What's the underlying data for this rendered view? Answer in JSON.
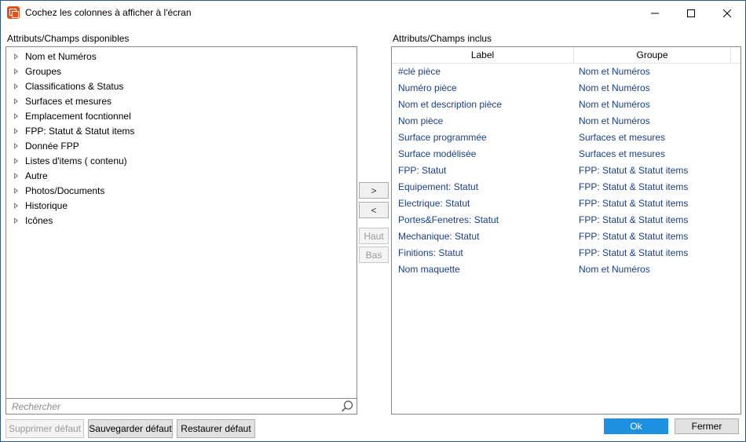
{
  "window": {
    "title": "Cochez les colonnes à afficher à l'écran"
  },
  "available": {
    "heading": "Attributs/Champs disponibles",
    "items": [
      {
        "label": "Nom et Numéros"
      },
      {
        "label": "Groupes"
      },
      {
        "label": "Classifications & Status"
      },
      {
        "label": "Surfaces et mesures"
      },
      {
        "label": "Emplacement focntionnel"
      },
      {
        "label": "FPP: Statut & Statut items"
      },
      {
        "label": "Donnée FPP"
      },
      {
        "label": "Listes d'items ( contenu)"
      },
      {
        "label": "Autre"
      },
      {
        "label": "Photos/Documents"
      },
      {
        "label": "Historique"
      },
      {
        "label": "Icônes"
      }
    ],
    "search_placeholder": "Rechercher"
  },
  "included": {
    "heading": "Attributs/Champs inclus",
    "columns": {
      "label": "Label",
      "group": "Groupe"
    },
    "rows": [
      {
        "label": "#clé pièce",
        "group": "Nom et Numéros"
      },
      {
        "label": "Numéro pièce",
        "group": "Nom et Numéros"
      },
      {
        "label": "Nom et description pièce",
        "group": "Nom et Numéros"
      },
      {
        "label": "Nom pièce",
        "group": "Nom et Numéros"
      },
      {
        "label": "Surface programmée",
        "group": "Surfaces et mesures"
      },
      {
        "label": "Surface modélisée",
        "group": "Surfaces et mesures"
      },
      {
        "label": "FPP: Statut",
        "group": "FPP: Statut & Statut items"
      },
      {
        "label": "Equipement: Statut",
        "group": "FPP: Statut & Statut items"
      },
      {
        "label": "Electrique: Statut",
        "group": "FPP: Statut & Statut items"
      },
      {
        "label": "Portes&Fenetres: Statut",
        "group": "FPP: Statut & Statut items"
      },
      {
        "label": "Mechanique: Statut",
        "group": "FPP: Statut & Statut items"
      },
      {
        "label": "Finitions: Statut",
        "group": "FPP: Statut & Statut items"
      },
      {
        "label": "Nom maquette",
        "group": "Nom et Numéros"
      }
    ]
  },
  "transfer": {
    "add": ">",
    "remove": "<",
    "up": "Haut",
    "down": "Bas"
  },
  "footer": {
    "delete_default": "Supprimer défaut",
    "save_default": "Sauvegarder défaut",
    "restore_default": "Restaurer défaut",
    "ok": "Ok",
    "close": "Fermer"
  },
  "colors": {
    "accent": "#1e90e0",
    "grid_text": "#1a3f8a",
    "window_border": "#2b579a",
    "app_icon": "#e0521f"
  },
  "icons": {
    "app": "app-logo-icon",
    "tree": "triangle-right-icon",
    "search": "search-icon"
  }
}
